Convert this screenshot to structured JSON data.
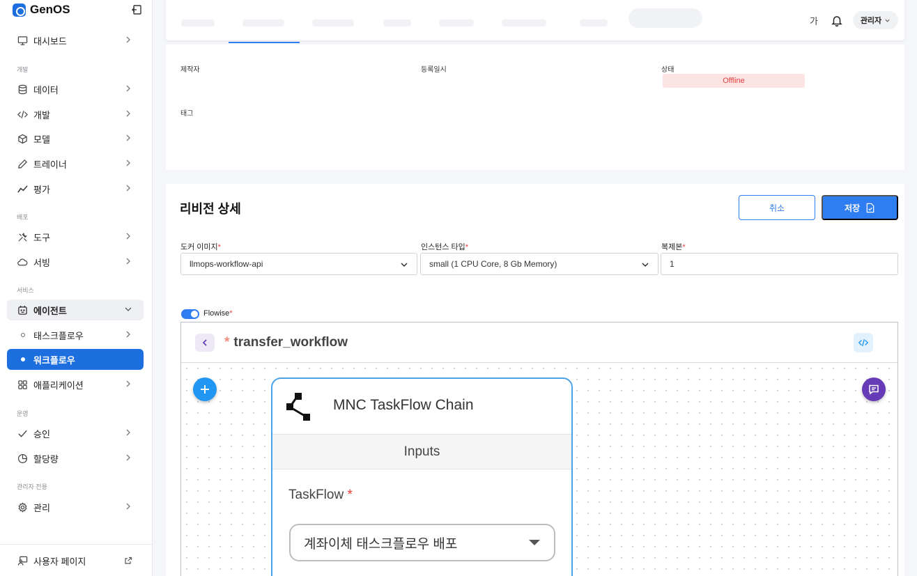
{
  "app": {
    "name": "GenOS"
  },
  "sidebar": {
    "dashboard": "대시보드",
    "sections": {
      "develop": "개발",
      "deploy": "배포",
      "service": "서비스",
      "operate": "운영",
      "admin_only": "관리자 전용"
    },
    "items": {
      "data": "데이터",
      "dev": "개발",
      "model": "모델",
      "trainer": "트레이너",
      "evaluation": "평가",
      "tools": "도구",
      "serving": "서빙",
      "agent": "에이전트",
      "taskflow": "태스크플로우",
      "workflow": "워크플로우",
      "application": "애플리케이션",
      "approval": "승인",
      "quota": "할당량",
      "management": "관리"
    },
    "footer": "사용자 페이지"
  },
  "header": {
    "font_toggle": "가",
    "user": "관리자"
  },
  "info": {
    "creator_label": "제작자",
    "registered_label": "등록일시",
    "status_label": "상태",
    "status_value": "Offline",
    "tags_label": "태그"
  },
  "revision": {
    "title": "리비전 상세",
    "cancel": "취소",
    "save": "저장",
    "docker_label": "도커 이미지",
    "docker_value": "llmops-workflow-api",
    "instance_label": "인스턴스 타입",
    "instance_value": "small (1 CPU Core, 8 Gb Memory)",
    "replica_label": "복제본",
    "replica_value": "1",
    "flowise_label": "Flowise",
    "required_mark": "*"
  },
  "flow": {
    "star": "*",
    "title": "transfer_workflow",
    "node": {
      "title": "MNC TaskFlow Chain",
      "inputs": "Inputs",
      "field_label": "TaskFlow",
      "field_value": "계좌이체 태스크플로우 배포"
    }
  },
  "colors": {
    "primary": "#2f7ef1",
    "brand": "#1d6fe0",
    "offline_bg": "#fde4e4",
    "offline_text": "#e53e3e",
    "add_button": "#2196f3",
    "chat_button": "#673ab7"
  }
}
